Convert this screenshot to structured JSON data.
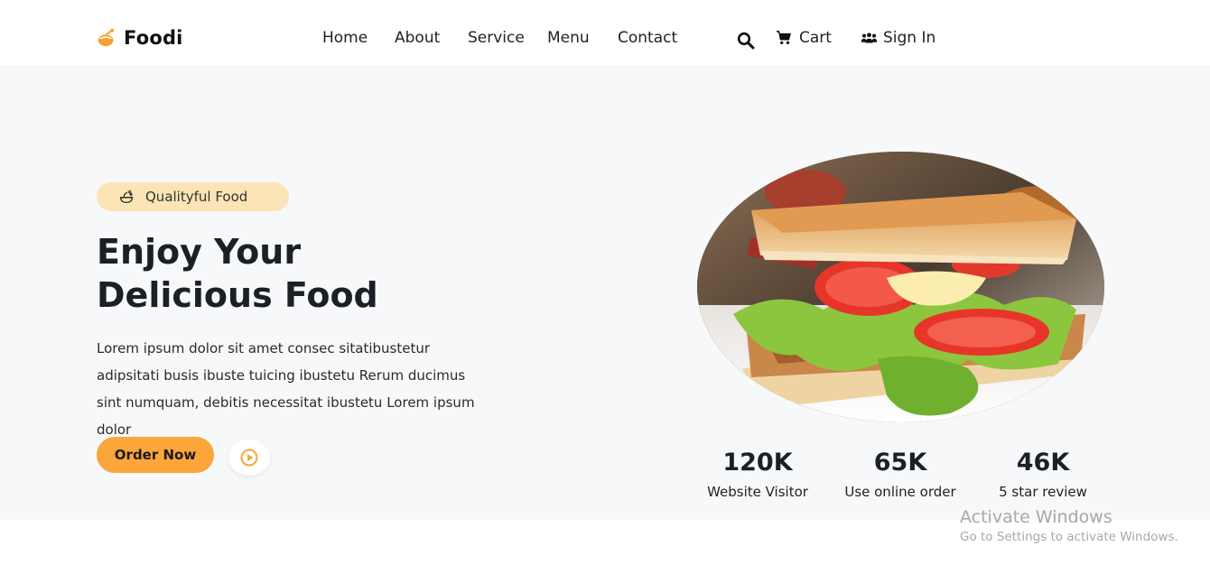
{
  "brand": {
    "name": "Foodi",
    "logo_icon": "chef-hat-icon"
  },
  "nav": {
    "items": [
      "Home",
      "About",
      "Service",
      "Menu",
      "Contact"
    ],
    "search_icon": "search-icon",
    "cart_label": "Cart",
    "signin_label": "Sign In"
  },
  "hero": {
    "badge_text": "Qualityful Food",
    "title_line1": "Enjoy Your",
    "title_line2": "Delicious Food",
    "description": "Lorem ipsum dolor sit amet consec sitatibustetur adipsitati busis ibuste tuicing ibustetu Rerum ducimus sint numquam, debitis necessitat ibustetu Lorem ipsum dolor",
    "order_button": "Order Now",
    "image_subject": "sandwich"
  },
  "stats": [
    {
      "value": "120K",
      "label": "Website Visitor"
    },
    {
      "value": "65K",
      "label": "Use online order"
    },
    {
      "value": "46K",
      "label": "5 star review"
    }
  ],
  "watermark": {
    "title": "Activate Windows",
    "subtitle": "Go to Settings to activate Windows."
  },
  "colors": {
    "accent": "#fba53a",
    "badge_bg": "#fbe4b6",
    "hero_bg": "#f7f8fa",
    "text_dark": "#1c1f26"
  }
}
